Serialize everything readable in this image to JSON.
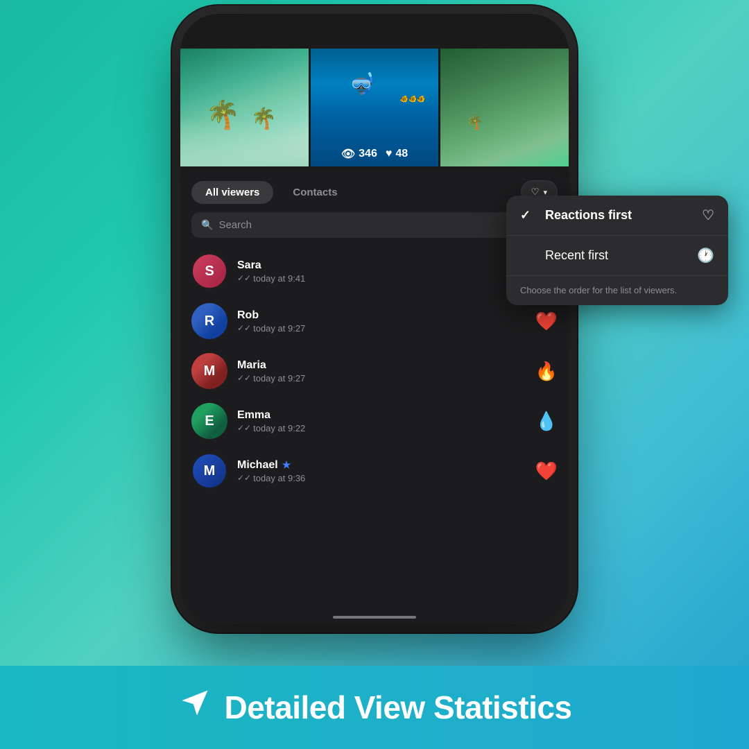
{
  "background": {
    "gradient_start": "#1ab8a0",
    "gradient_end": "#20a8d0"
  },
  "phone": {
    "images": {
      "stats": {
        "views_icon": "👁",
        "views_count": "346",
        "likes_icon": "♥",
        "likes_count": "48"
      }
    },
    "tabs": {
      "all_viewers_label": "All viewers",
      "contacts_label": "Contacts"
    },
    "sort_button": {
      "heart_icon": "♡",
      "chevron_icon": "∨"
    },
    "search": {
      "placeholder": "Search",
      "icon": "🔍"
    },
    "viewers": [
      {
        "name": "Sara",
        "time": "today at 9:41",
        "reaction": null,
        "has_ring": true
      },
      {
        "name": "Rob",
        "time": "today at 9:27",
        "reaction": "❤️",
        "has_ring": false
      },
      {
        "name": "Maria",
        "time": "today at 9:27",
        "reaction": "🔥",
        "has_ring": false
      },
      {
        "name": "Emma",
        "time": "today at 9:22",
        "reaction": "💧",
        "has_ring": false
      },
      {
        "name": "Michael",
        "time": "today at 9:36",
        "reaction": "❤️",
        "has_ring": true,
        "has_star": true
      }
    ]
  },
  "dropdown": {
    "reactions_first_label": "Reactions first",
    "reactions_first_icon": "♡",
    "recent_first_label": "Recent first",
    "recent_first_icon": "🕐",
    "tip_text": "Choose the order for the list of viewers.",
    "active_item": "reactions_first"
  },
  "footer": {
    "icon": "✈",
    "title": "Detailed View Statistics"
  }
}
